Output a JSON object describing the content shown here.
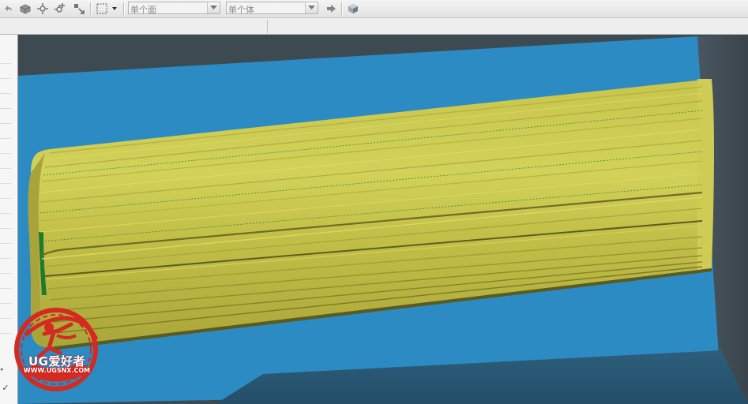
{
  "toolbar": {
    "icons": [
      "undo-icon",
      "solid-icon",
      "snap-point-icon",
      "snap-point-plus-icon",
      "snap-settings-icon",
      "selection-box-icon",
      "play-arrow-icon",
      "shaded-cube-icon"
    ],
    "face_filter": {
      "value": "单个面"
    },
    "body_filter": {
      "value": "单个体"
    }
  },
  "navigator": {
    "check_glyph": "✓",
    "scroll_glyph": "▸"
  },
  "watermark": {
    "brand": "UG爱好者",
    "url": "WWW.UGSNX.COM"
  },
  "colors": {
    "background_blue": "#2c8cc4",
    "part_yellow": "#c9c84a",
    "edge_dark": "#3f4f58",
    "watermark_red": "#d42a21"
  }
}
